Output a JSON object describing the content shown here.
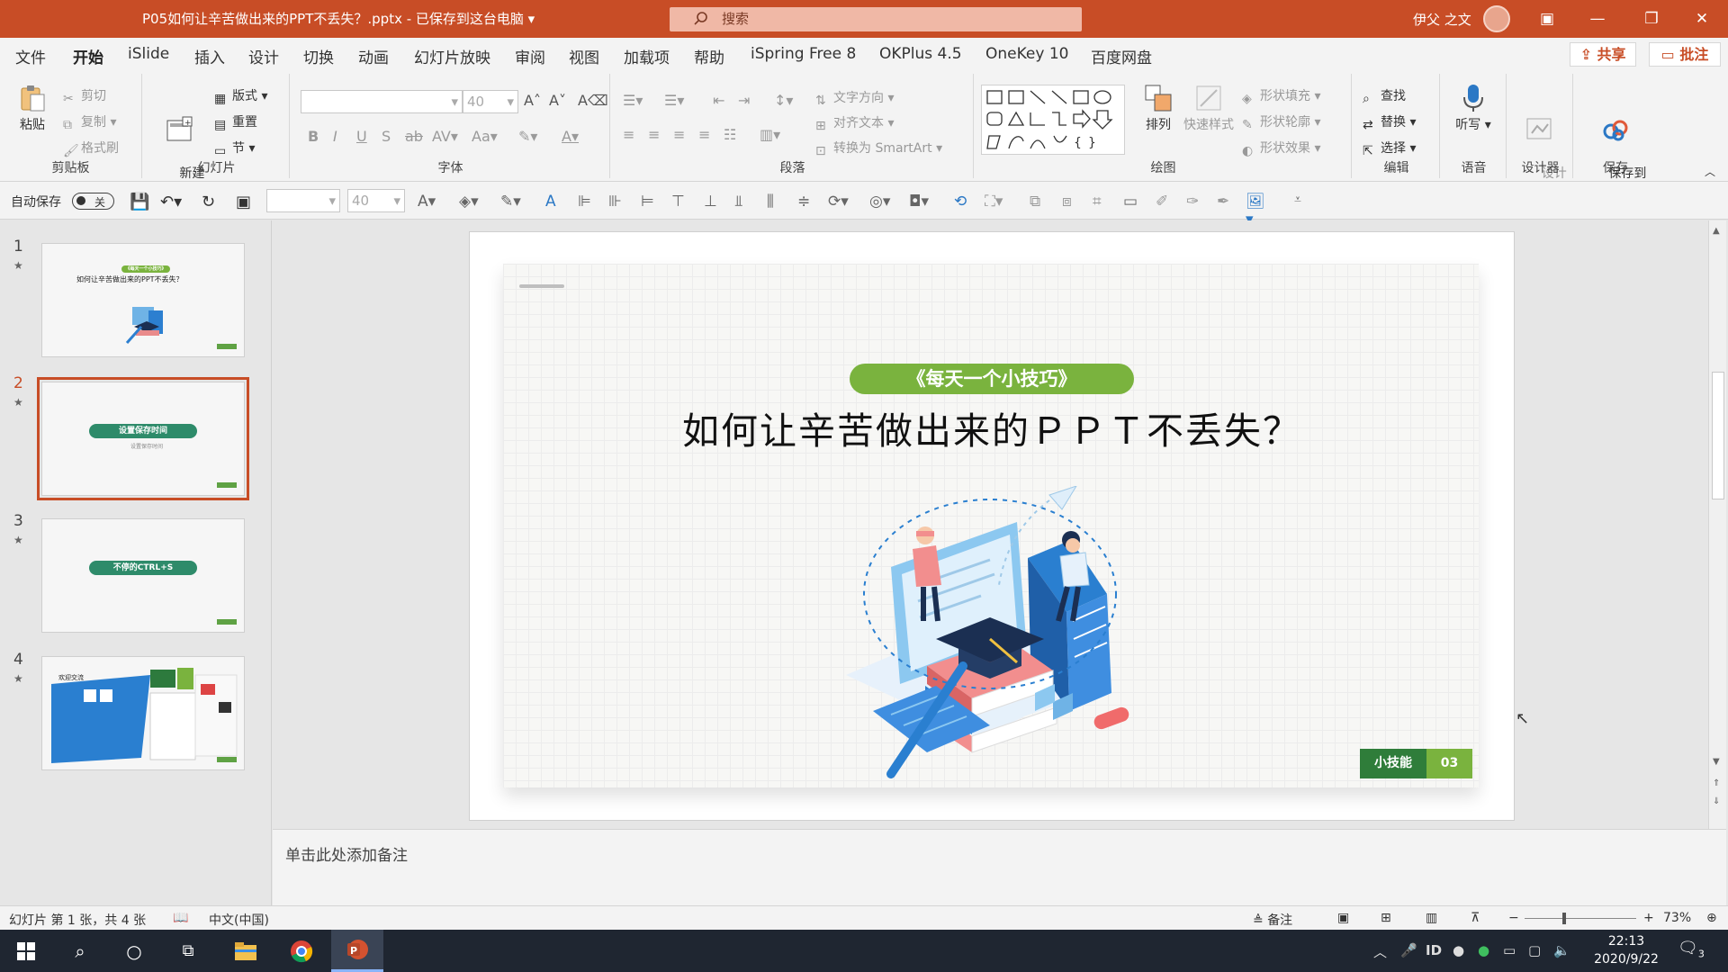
{
  "titlebar": {
    "doc_title": "P05如何让辛苦做出来的PPT不丢失？.pptx  -  已保存到这台电脑  ▾",
    "search_placeholder": "搜索",
    "user_name": "伊父 之文",
    "accent_color": "#c84d26"
  },
  "menu": {
    "tabs": [
      "文件",
      "开始",
      "iSlide",
      "插入",
      "设计",
      "切换",
      "动画",
      "幻灯片放映",
      "审阅",
      "视图",
      "加载项",
      "帮助",
      "iSpring Free 8",
      "OKPlus 4.5",
      "OneKey 10",
      "百度网盘"
    ],
    "active_tab": "开始",
    "share_label": "共享",
    "comment_label": "批注"
  },
  "ribbon": {
    "clipboard": {
      "paste": "粘贴",
      "cut": "剪切",
      "copy": "复制",
      "format_painter": "格式刷",
      "group": "剪贴板"
    },
    "slides": {
      "new_slide": "新建\n幻灯片",
      "layout": "版式",
      "reset": "重置",
      "section": "节",
      "group": "幻灯片"
    },
    "font": {
      "size": "40",
      "group": "字体"
    },
    "paragraph": {
      "text_direction": "文字方向",
      "align_text": "对齐文本",
      "smartart": "转换为 SmartArt",
      "group": "段落"
    },
    "drawing": {
      "arrange": "排列",
      "quick_styles": "快速样式",
      "shape_fill": "形状填充",
      "shape_outline": "形状轮廓",
      "shape_effects": "形状效果",
      "group": "绘图"
    },
    "editing": {
      "find": "查找",
      "replace": "替换",
      "select": "选择",
      "group": "编辑"
    },
    "voice": {
      "dictate": "听写",
      "group": "语音"
    },
    "designer": {
      "ideas": "设计\n灵感",
      "group": "设计器"
    },
    "save": {
      "save_baidu": "保存到\n百度网盘",
      "group": "保存"
    }
  },
  "qat": {
    "autosave_label": "自动保存",
    "autosave_state": "关",
    "font_size": "40"
  },
  "thumbnails": [
    {
      "num": "1",
      "title": "如何让辛苦做出来的PPT不丢失？",
      "pill": "《每天一个小技巧》"
    },
    {
      "num": "2",
      "pill": "设置保存时间",
      "sub": "设置保存时间"
    },
    {
      "num": "3",
      "pill": "不停的CTRL+S"
    },
    {
      "num": "4",
      "title": "欢迎交流"
    }
  ],
  "slide": {
    "pill": "《每天一个小技巧》",
    "title": "如何让辛苦做出来的ＰＰＴ不丢失？",
    "tag_left": "小技能",
    "tag_right": "03",
    "green": "#7ab33e",
    "dark_green": "#2f7d3a"
  },
  "notes": {
    "placeholder": "单击此处添加备注"
  },
  "statusbar": {
    "slide_info": "幻灯片 第 1 张，共 4 张",
    "language": "中文(中国)",
    "notes_label": "备注",
    "zoom": "73%"
  },
  "taskbar": {
    "time": "22:13",
    "date": "2020/9/22",
    "notif_count": "3"
  }
}
